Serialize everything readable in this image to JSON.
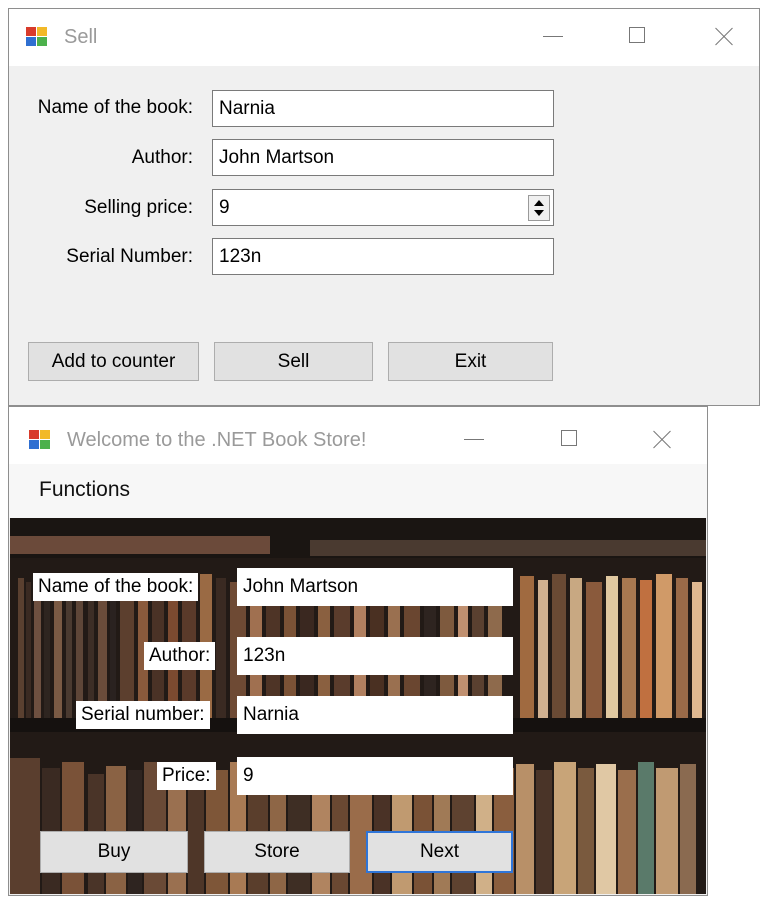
{
  "sell_window": {
    "title": "Sell",
    "fields": [
      {
        "label": "Name of the book:",
        "value": "Narnia"
      },
      {
        "label": "Author:",
        "value": "John Martson"
      },
      {
        "label": "Selling price:",
        "value": "9"
      },
      {
        "label": "Serial Number:",
        "value": "123n"
      }
    ],
    "buttons": {
      "add_to_counter": "Add to counter",
      "sell": "Sell",
      "exit": "Exit"
    }
  },
  "store_window": {
    "title": "Welcome to the .NET Book Store!",
    "menu": {
      "functions": "Functions"
    },
    "fields": [
      {
        "label": "Name of the book:",
        "value": "John Martson"
      },
      {
        "label": "Author:",
        "value": "123n"
      },
      {
        "label": "Serial number:",
        "value": "Narnia"
      },
      {
        "label": "Price:",
        "value": "9"
      }
    ],
    "buttons": {
      "buy": "Buy",
      "store": "Store",
      "next": "Next"
    }
  },
  "colors": {
    "accent_focus": "#2f75d8",
    "window_bg": "#f0f0f0",
    "title_text": "#9a9a9a"
  },
  "icons": {
    "app": "app-icon",
    "minimize": "minimize-icon",
    "maximize": "maximize-icon",
    "close": "close-icon",
    "spinner": "spinner-updown-icon"
  }
}
